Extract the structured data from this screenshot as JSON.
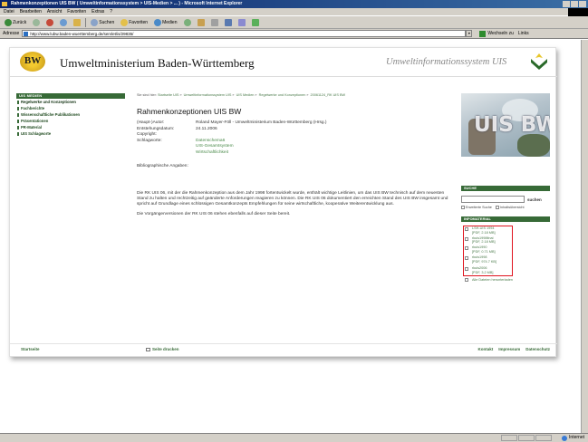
{
  "browser": {
    "title": "Rahmenkonzeptionen UIS BW ( Umweltinformationssystem > UIS-Medien > ... ) - Microsoft Internet Explorer",
    "menu": [
      "Datei",
      "Bearbeiten",
      "Ansicht",
      "Favoriten",
      "Extras",
      "?"
    ],
    "toolbar": {
      "back": "Zurück",
      "search": "Suchen",
      "favorites": "Favoriten",
      "media": "Medien"
    },
    "address_label": "Adresse",
    "address_value": "http://www.lubw.baden-wuerttemberg.de/servlet/is/29835/",
    "go_label": "Wechseln zu",
    "links_label": "Links",
    "status_zone": "Internet"
  },
  "header": {
    "logo_letters": "BW",
    "site_title": "Umweltministerium Baden-Württemberg",
    "site_subtitle": "Umweltinformationssystem UIS"
  },
  "nav": {
    "heading": "UIS MEDIEN",
    "items": [
      {
        "label": "Regelwerke und Konzeptionen"
      },
      {
        "label": "Fachberichte"
      },
      {
        "label": "Wissenschaftliche Publikationen"
      },
      {
        "label": "Präsentationen"
      },
      {
        "label": "PR-Material"
      },
      {
        "label": "UIS Schlagworte"
      }
    ]
  },
  "breadcrumb": {
    "prefix": "Sie sind hier:",
    "items": [
      "Startseite UIS",
      "Umweltinformationssystem UIS",
      "UIS Medien",
      "Regelwerke und Konzeptionen",
      "20061124_RK UIS BW"
    ]
  },
  "page": {
    "heading": "Rahmenkonzeptionen UIS BW",
    "meta": [
      {
        "key": "(Haupt-)Autor:",
        "value": "Roland Mayer-Föll - Umweltministerium Baden-Württemberg (Hrsg.)"
      },
      {
        "key": "Entstehungsdatum:",
        "value": "24.11.2006"
      },
      {
        "key": "Copyright:",
        "value": ""
      }
    ],
    "keywords_label": "Schlagworte:",
    "keywords": [
      "Datenschema6",
      "UIS-Gesamtsystem",
      "Wirtschaftlichkeit"
    ],
    "bib_label": "Bibliographische Angaben:",
    "description": "Die RK UIS 06, mit der die Rahmenkonzeption aus dem Jahr 1998 fortentwickelt wurde, enthält wichtige Leitlinien, um das UIS BW technisch auf dem neuesten Stand zu halten und rechtzeitig auf geänderte Anforderungen reagieren zu können. Die RK UIS 06 dokumentiert den erreichten Stand des UIS BW insgesamt und spricht auf Grundlage eines schlüssigen Gesamtkonzepts Empfehlungen für seine wirtschaftliche, kooperative Weiterentwicklung aus.",
    "description2": "Die Vorgängerversionen der RK UIS 06 stehen ebenfalls auf dieser Seite bereit."
  },
  "right": {
    "image_text": "UIS BW",
    "search_heading": "SUCHE",
    "search_button": "suchen",
    "search_opt1": "Erweiterte Suche",
    "search_opt2": "Inhaltsübersicht",
    "info_heading": "INFOMATERIAL",
    "info_items": [
      {
        "line1": "LSH-UIS 1994",
        "line2": "[PDF, 2.18 MB]"
      },
      {
        "line1": "rkuis1998final",
        "line2": "[PDF, 2.18 MB]"
      },
      {
        "line1": "rkuis1990",
        "line2": "[PDF, 0.71 MB]"
      },
      {
        "line1": "rkuis1998",
        "line2": "[PDF, 974.7 KB]"
      },
      {
        "line1": "rkuis2006",
        "line2": "[PDF, 3.2 MB]"
      }
    ],
    "all_files": "Alle Dateien herunterladen"
  },
  "footer": {
    "start": "Startseite",
    "print": "Seite drucken",
    "links": [
      "Kontakt",
      "Impressum",
      "Datenschutz"
    ]
  },
  "colors": {
    "accent_green": "#376a37",
    "link_green": "#4a8a4a",
    "highlight_red": "#e0141e"
  }
}
